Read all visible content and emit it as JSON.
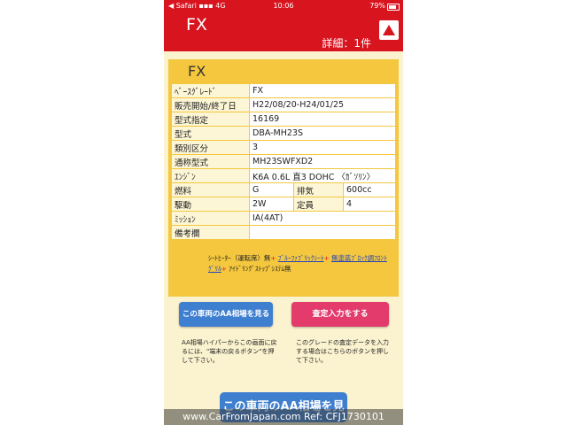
{
  "status_bar": {
    "back": "◀ Safari",
    "signal": "4G",
    "time": "10:06",
    "battery_pct": "79%"
  },
  "header": {
    "title": "FX",
    "count": "詳細：1件"
  },
  "card": {
    "title": "FX",
    "rows": [
      {
        "label": "ﾍﾞｰｽｸﾞﾚｰﾄﾞ",
        "value": "FX"
      },
      {
        "label": "販売開始/終了日",
        "value": "H22/08/20-H24/01/25"
      },
      {
        "label": "型式指定",
        "value": "16169"
      },
      {
        "label": "型式",
        "value": "DBA-MH23S"
      },
      {
        "label": "類別区分",
        "value": "3"
      },
      {
        "label": "通称型式",
        "value": "MH23SWFXD2"
      },
      {
        "label": "ｴﾝｼﾞﾝ",
        "value": "K6A 0.6L 直3 DOHC 〈ｶﾞｿﾘﾝ〉"
      },
      {
        "label": "燃料",
        "value": "G",
        "label2": "排気",
        "value2": "600cc"
      },
      {
        "label": "駆動",
        "value": "2W",
        "label2": "定員",
        "value2": "4"
      },
      {
        "label": "ﾐｯｼｮﾝ",
        "value": "IA(4AT)"
      },
      {
        "label": "備考欄",
        "value": ""
      }
    ],
    "notes": {
      "t1": "ｼｰﾄﾋｰﾀｰ（運転席）無",
      "plus": "+",
      "link1": "ﾌﾞﾙｰﾌｧﾌﾞﾘｯｸｼｰﾄ",
      "link2": "無塗装ﾌﾞﾛｯｸ調ﾌﾛﾝﾄｸﾞﾘﾙ",
      "t2": "ｱｲﾄﾞﾘﾝｸﾞｽﾄｯﾌﾟｼｽﾃﾑ無"
    }
  },
  "buttons": {
    "aa_price": "この車両のAA相場を見る",
    "assessment": "査定入力をする",
    "aa_price_large": "この車両のAA相場を見る"
  },
  "help": {
    "left": "AA相場ハイパーからこの画面に戻るには、\"端末の戻るボタン\"を押して下さい。",
    "right": "このグレードの査定データを入力する場合はこちらのボタンを押して下さい。"
  },
  "watermark": "www.CarFromJapan.com Ref: CFJ1730101"
}
